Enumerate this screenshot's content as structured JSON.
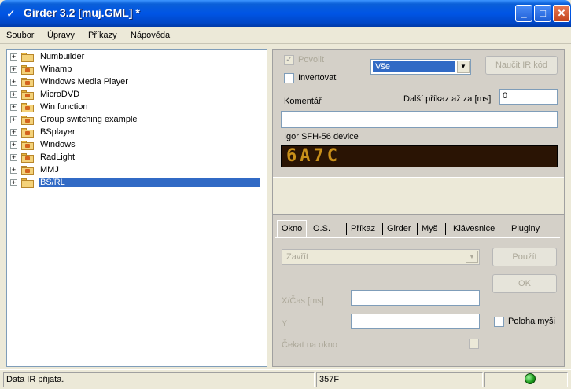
{
  "window": {
    "title": "Girder 3.2 [muj.GML] *"
  },
  "menu": [
    "Soubor",
    "Úpravy",
    "Příkazy",
    "Nápověda"
  ],
  "tree": {
    "items": [
      {
        "label": "Numbuilder"
      },
      {
        "label": "Winamp"
      },
      {
        "label": "Windows Media Player"
      },
      {
        "label": "MicroDVD"
      },
      {
        "label": "Win function"
      },
      {
        "label": "Group switching example"
      },
      {
        "label": "BSplayer"
      },
      {
        "label": "Windows"
      },
      {
        "label": "RadLight"
      },
      {
        "label": "MMJ"
      },
      {
        "label": "BS/RL",
        "selected": true
      }
    ]
  },
  "panel": {
    "enable_label": "Povolit",
    "invert_label": "Invertovat",
    "combo_value": "Vše",
    "learn_button": "Naučit IR kód",
    "next_cmd_label": "Další příkaz až za [ms]",
    "next_cmd_value": "0",
    "comment_label": "Komentář",
    "comment_value": "",
    "device_label": "Igor SFH-56 device",
    "lcd_value": "6A7C"
  },
  "tabs": [
    "Okno",
    "O.S.",
    "Příkaz",
    "Girder",
    "Myš",
    "Klávesnice",
    "Pluginy"
  ],
  "tab_okno": {
    "action_value": "Zavřít",
    "apply_button": "Použít",
    "ok_button": "OK",
    "time_label": "X/Čas [ms]",
    "time_value": "",
    "y_label": "Y",
    "y_value": "",
    "mouse_pos_label": "Poloha myši",
    "wait_label": "Čekat na okno"
  },
  "statusbar": {
    "message": "Data IR přijata.",
    "code": "357F"
  },
  "colors": {
    "title_bar": "#0055e5",
    "selection": "#316ac5",
    "lcd_bg": "#2a1404",
    "lcd_fg": "#c9901a",
    "led": "#1a9a1a"
  }
}
